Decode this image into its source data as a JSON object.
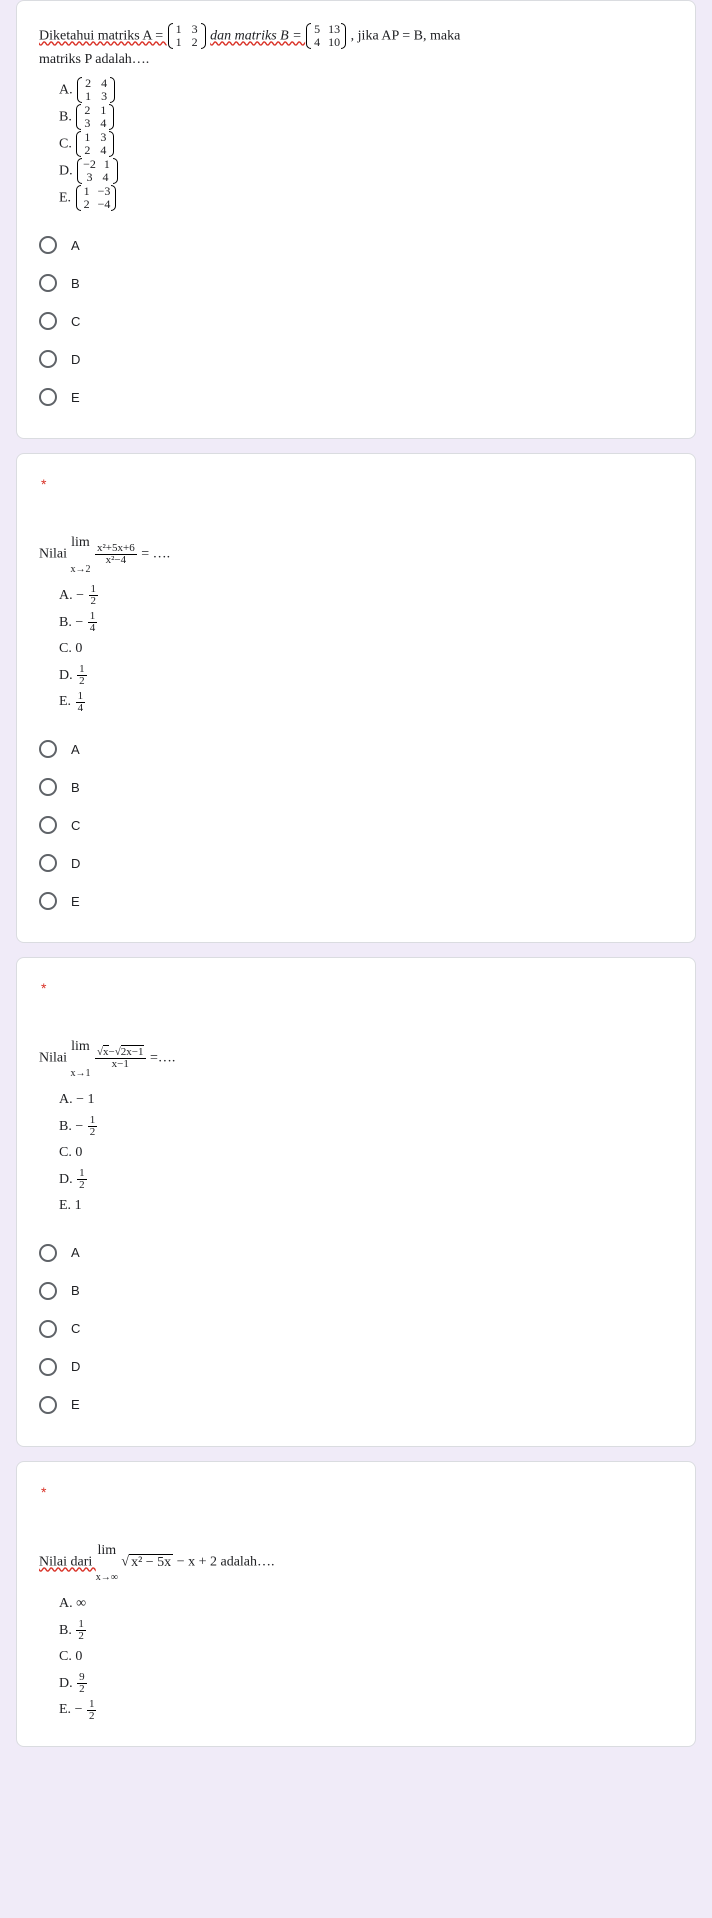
{
  "q1": {
    "prompt_pre": "Diketahui matriks A = ",
    "matrix_A": [
      [
        "1",
        "3"
      ],
      [
        "1",
        "2"
      ]
    ],
    "prompt_mid": " dan matriks B = ",
    "matrix_B": [
      [
        "5",
        "13"
      ],
      [
        "4",
        "10"
      ]
    ],
    "prompt_post": ", jika AP = B, maka",
    "prompt_line2": "matriks P adalah….",
    "subs": {
      "A": {
        "label": "A.",
        "m": [
          [
            "2",
            "4"
          ],
          [
            "1",
            "3"
          ]
        ]
      },
      "B": {
        "label": "B.",
        "m": [
          [
            "2",
            "1"
          ],
          [
            "3",
            "4"
          ]
        ]
      },
      "C": {
        "label": "C.",
        "m": [
          [
            "1",
            "3"
          ],
          [
            "2",
            "4"
          ]
        ]
      },
      "D": {
        "label": "D.",
        "m": [
          [
            "−2",
            "1"
          ],
          [
            "3",
            "4"
          ]
        ]
      },
      "E": {
        "label": "E.",
        "m": [
          [
            "1",
            "−3"
          ],
          [
            "2",
            "−4"
          ]
        ]
      }
    },
    "options": [
      "A",
      "B",
      "C",
      "D",
      "E"
    ]
  },
  "q2": {
    "prompt_pre": "Nilai ",
    "lim_label": "lim",
    "lim_sub": "x→2",
    "frac_num": "x²+5x+6",
    "frac_den": "x²−4",
    "prompt_post": " = ….",
    "subs": {
      "A": {
        "label": "A.",
        "txt_pre": "− ",
        "num": "1",
        "den": "2"
      },
      "B": {
        "label": "B.",
        "txt_pre": "− ",
        "num": "1",
        "den": "4"
      },
      "C": {
        "label": "C.",
        "txt": "0"
      },
      "D": {
        "label": "D.",
        "num": "1",
        "den": "2"
      },
      "E": {
        "label": "E.",
        "num": "1",
        "den": "4"
      }
    },
    "options": [
      "A",
      "B",
      "C",
      "D",
      "E"
    ]
  },
  "q3": {
    "prompt_pre": "Nilai ",
    "lim_label": "lim",
    "lim_sub": "x→1",
    "frac_num_a": "x",
    "frac_num_b": "2x−1",
    "frac_den": "x−1",
    "prompt_post": " =….",
    "subs": {
      "A": {
        "label": "A.",
        "txt": "− 1"
      },
      "B": {
        "label": "B.",
        "txt_pre": "− ",
        "num": "1",
        "den": "2"
      },
      "C": {
        "label": "C.",
        "txt": "0"
      },
      "D": {
        "label": "D.",
        "num": "1",
        "den": "2"
      },
      "E": {
        "label": "E.",
        "txt": "1"
      }
    },
    "options": [
      "A",
      "B",
      "C",
      "D",
      "E"
    ]
  },
  "q4": {
    "prompt_pre": "Nilai dari ",
    "lim_label": "lim",
    "lim_sub": "x→∞",
    "rad": "x² − 5x",
    "prompt_mid": " − x + 2 adalah….",
    "subs": {
      "A": {
        "label": "A.",
        "txt": "∞"
      },
      "B": {
        "label": "B.",
        "num": "1",
        "den": "2"
      },
      "C": {
        "label": "C.",
        "txt": "0"
      },
      "D": {
        "label": "D.",
        "num": "9",
        "den": "2"
      },
      "E": {
        "label": "E.",
        "txt_pre": "− ",
        "num": "1",
        "den": "2"
      }
    }
  }
}
